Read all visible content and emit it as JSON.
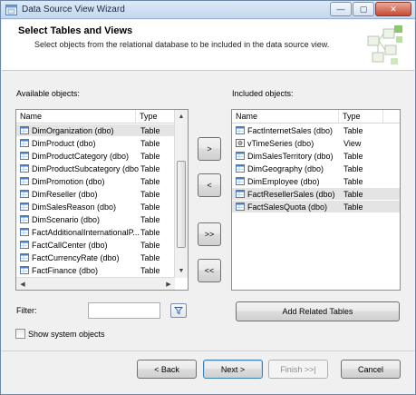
{
  "window": {
    "title": "Data Source View Wizard",
    "minimize": "—",
    "maximize": "▢",
    "close": "✕"
  },
  "header": {
    "title": "Select Tables and Views",
    "subtitle": "Select objects from the relational database to be included in the data source view."
  },
  "available": {
    "label": "Available objects:",
    "columns": [
      "Name",
      "Type"
    ],
    "rows": [
      {
        "name": "DimOrganization (dbo)",
        "type": "Table",
        "icon": "table-icon",
        "selected": true
      },
      {
        "name": "DimProduct (dbo)",
        "type": "Table",
        "icon": "table-icon"
      },
      {
        "name": "DimProductCategory (dbo)",
        "type": "Table",
        "icon": "table-icon"
      },
      {
        "name": "DimProductSubcategory (dbo)",
        "type": "Table",
        "icon": "table-icon"
      },
      {
        "name": "DimPromotion (dbo)",
        "type": "Table",
        "icon": "table-icon"
      },
      {
        "name": "DimReseller (dbo)",
        "type": "Table",
        "icon": "table-icon"
      },
      {
        "name": "DimSalesReason (dbo)",
        "type": "Table",
        "icon": "table-icon"
      },
      {
        "name": "DimScenario (dbo)",
        "type": "Table",
        "icon": "table-icon"
      },
      {
        "name": "FactAdditionalInternationalP...",
        "type": "Table",
        "icon": "table-icon"
      },
      {
        "name": "FactCallCenter (dbo)",
        "type": "Table",
        "icon": "table-icon"
      },
      {
        "name": "FactCurrencyRate (dbo)",
        "type": "Table",
        "icon": "table-icon"
      },
      {
        "name": "FactFinance (dbo)",
        "type": "Table",
        "icon": "table-icon"
      }
    ]
  },
  "included": {
    "label": "Included objects:",
    "columns": [
      "Name",
      "Type"
    ],
    "rows": [
      {
        "name": "FactInternetSales (dbo)",
        "type": "Table",
        "icon": "table-icon"
      },
      {
        "name": "vTimeSeries (dbo)",
        "type": "View",
        "icon": "view-icon"
      },
      {
        "name": "DimSalesTerritory (dbo)",
        "type": "Table",
        "icon": "table-icon"
      },
      {
        "name": "DimGeography (dbo)",
        "type": "Table",
        "icon": "table-icon"
      },
      {
        "name": "DimEmployee (dbo)",
        "type": "Table",
        "icon": "table-icon"
      },
      {
        "name": "FactResellerSales (dbo)",
        "type": "Table",
        "icon": "table-icon",
        "selected": true
      },
      {
        "name": "FactSalesQuota (dbo)",
        "type": "Table",
        "icon": "table-icon",
        "selected": true
      }
    ]
  },
  "move_buttons": {
    "add": ">",
    "remove": "<",
    "add_all": ">>",
    "remove_all": "<<"
  },
  "filter": {
    "label": "Filter:",
    "value": ""
  },
  "add_related_label": "Add Related Tables",
  "show_system_label": "Show system objects",
  "show_system_checked": false,
  "footer": {
    "back": "< Back",
    "next": "Next >",
    "finish": "Finish >>|",
    "cancel": "Cancel"
  },
  "colors": {
    "accent": "#3c7fb1",
    "table_icon": "#4a7ebb",
    "selection": "#e4e4e4"
  }
}
